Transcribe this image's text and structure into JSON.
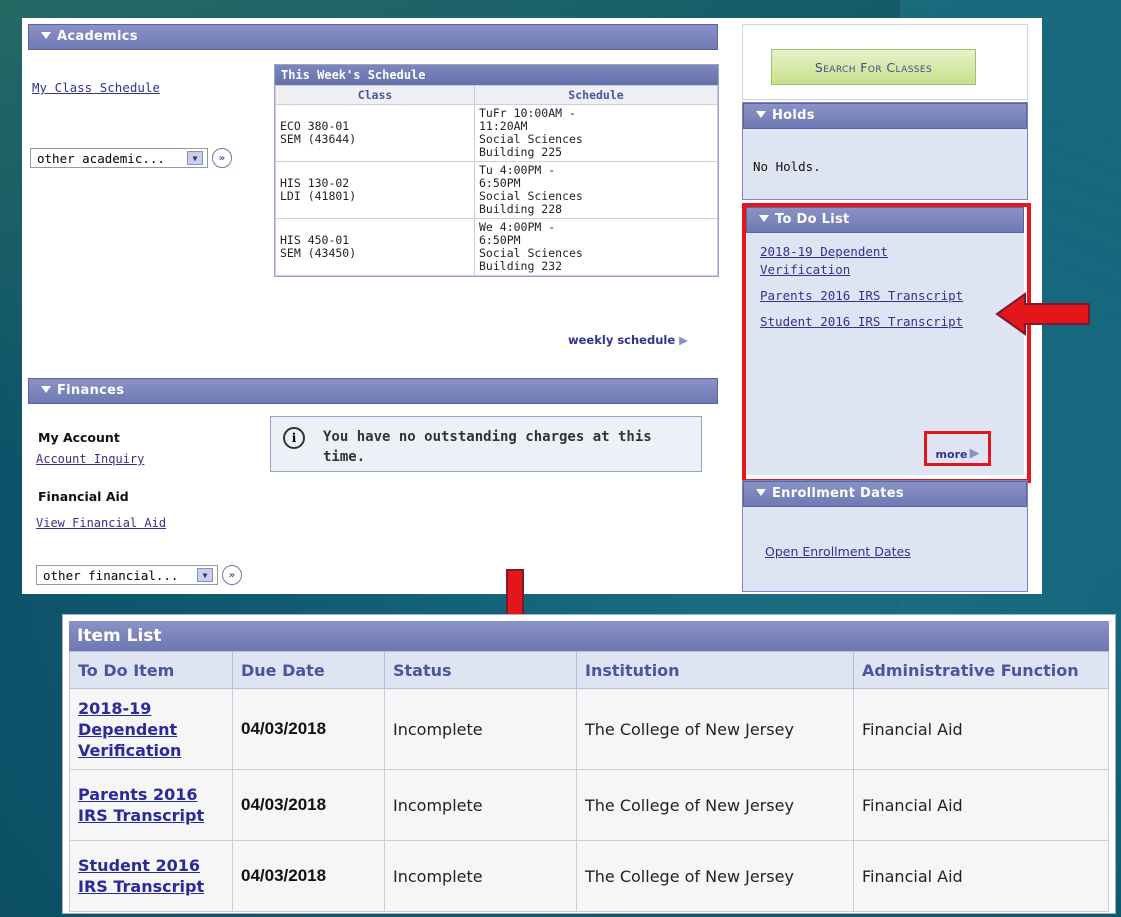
{
  "academics": {
    "title": "Academics",
    "my_class_schedule": "My Class Schedule",
    "other_select": "other academic...",
    "schedule": {
      "title": "This Week's Schedule",
      "headers": [
        "Class",
        "Schedule"
      ],
      "rows": [
        {
          "cls1": "ECO 380-01",
          "cls2": "SEM (43644)",
          "s1": "TuFr 10:00AM -",
          "s2": "11:20AM",
          "s3": "Social Sciences",
          "s4": "Building 225"
        },
        {
          "cls1": "HIS 130-02",
          "cls2": "LDI (41801)",
          "s1": "Tu 4:00PM -",
          "s2": "6:50PM",
          "s3": "Social Sciences",
          "s4": "Building 228"
        },
        {
          "cls1": "HIS 450-01",
          "cls2": "SEM (43450)",
          "s1": "We 4:00PM -",
          "s2": "6:50PM",
          "s3": "Social Sciences",
          "s4": "Building 232"
        }
      ],
      "weekly_link": "weekly schedule"
    }
  },
  "finances": {
    "title": "Finances",
    "my_account": "My Account",
    "account_inquiry": "Account Inquiry",
    "financial_aid": "Financial Aid",
    "view_financial_aid": "View Financial Aid",
    "other_select": "other financial...",
    "info_line1": "You have no outstanding charges at this",
    "info_line2": "time."
  },
  "right": {
    "search_button": "Search For Classes",
    "holds_title": "Holds",
    "holds_text": "No Holds.",
    "todo_title": "To Do List",
    "todo_items": [
      {
        "line1": "2018-19 Dependent",
        "line2": "Verification"
      },
      {
        "line1": "Parents 2016 IRS Transcript",
        "line2": ""
      },
      {
        "line1": "Student 2016 IRS Transcript",
        "line2": ""
      }
    ],
    "more_link": "more",
    "enroll_title": "Enrollment Dates",
    "enroll_link": "Open Enrollment Dates"
  },
  "item_list": {
    "title": "Item List",
    "headers": [
      "To Do Item",
      "Due Date",
      "Status",
      "Institution",
      "Administrative Function"
    ],
    "rows": [
      {
        "item_l1": "2018-19",
        "item_l2": "Dependent",
        "item_l3": "Verification",
        "due": "04/03/2018",
        "status": "Incomplete",
        "institution": "The College of New Jersey",
        "function": "Financial Aid"
      },
      {
        "item_l1": "Parents 2016",
        "item_l2": "IRS Transcript",
        "item_l3": "",
        "due": "04/03/2018",
        "status": "Incomplete",
        "institution": "The College of New Jersey",
        "function": "Financial Aid"
      },
      {
        "item_l1": "Student 2016",
        "item_l2": "IRS Transcript",
        "item_l3": "",
        "due": "04/03/2018",
        "status": "Incomplete",
        "institution": "The College of New Jersey",
        "function": "Financial Aid"
      }
    ]
  },
  "colors": {
    "highlight": "#e3161c",
    "header": "#6f79b3",
    "link": "#33338f"
  }
}
